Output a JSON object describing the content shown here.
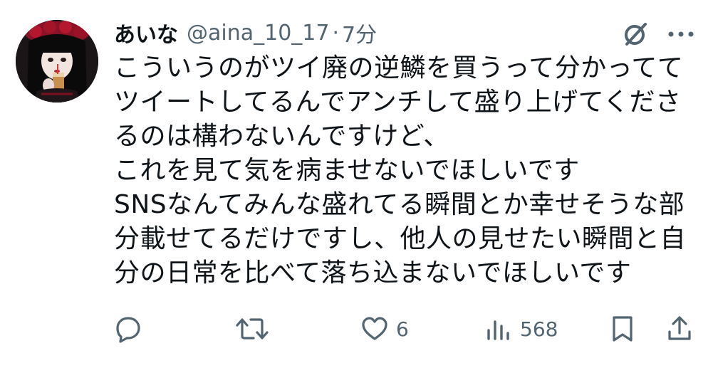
{
  "author": {
    "display_name": "あいな",
    "handle": "@aina_10_17",
    "separator": "·",
    "time": "7分"
  },
  "body_lines": [
    "こういうのがツイ廃の逆鱗を買うって分かってて",
    "ツイートしてるんでアンチして盛り上げてくださ",
    "るのは構わないんですけど、",
    "これを見て気を病ませないでほしいです",
    "SNSなんてみんな盛れてる瞬間とか幸せそうな部",
    "分載せてるだけですし、他人の見せたい瞬間と自",
    "分の日常を比べて落ち込まないでほしいです"
  ],
  "actions": {
    "reply_icon": "reply-icon",
    "retweet_icon": "retweet-icon",
    "like_icon": "heart-icon",
    "like_count": "6",
    "views_icon": "views-icon",
    "views_count": "568",
    "bookmark_icon": "bookmark-icon",
    "share_icon": "share-icon"
  },
  "colors": {
    "text": "#0f1419",
    "secondary": "#536471",
    "background": "#ffffff"
  }
}
